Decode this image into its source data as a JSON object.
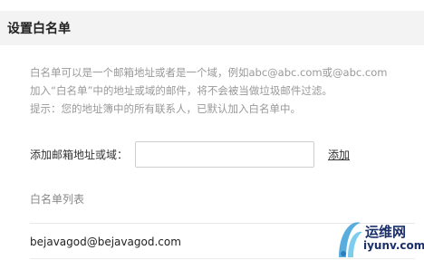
{
  "header": {
    "title": "设置白名单"
  },
  "description": {
    "line1": "白名单可以是一个邮箱地址或者是一个域，例如abc@abc.com或@abc.com",
    "line2": "加入“白名单”中的地址或域的邮件，将不会被当做垃圾邮件过滤。",
    "line3": "提示：您的地址簿中的所有联系人，已默认加入白名单中。"
  },
  "add_form": {
    "label": "添加邮箱地址或域：",
    "input_value": "",
    "add_link": "添加"
  },
  "whitelist": {
    "title": "白名单列表",
    "items": [
      "bejavagod@bejavagod.com"
    ]
  },
  "watermark": {
    "name": "运维网",
    "domain": "iyunv.com"
  },
  "colors": {
    "header_bg": "#f3f3f3",
    "muted_text": "#999999",
    "watermark_blue": "#1a2f6b"
  }
}
